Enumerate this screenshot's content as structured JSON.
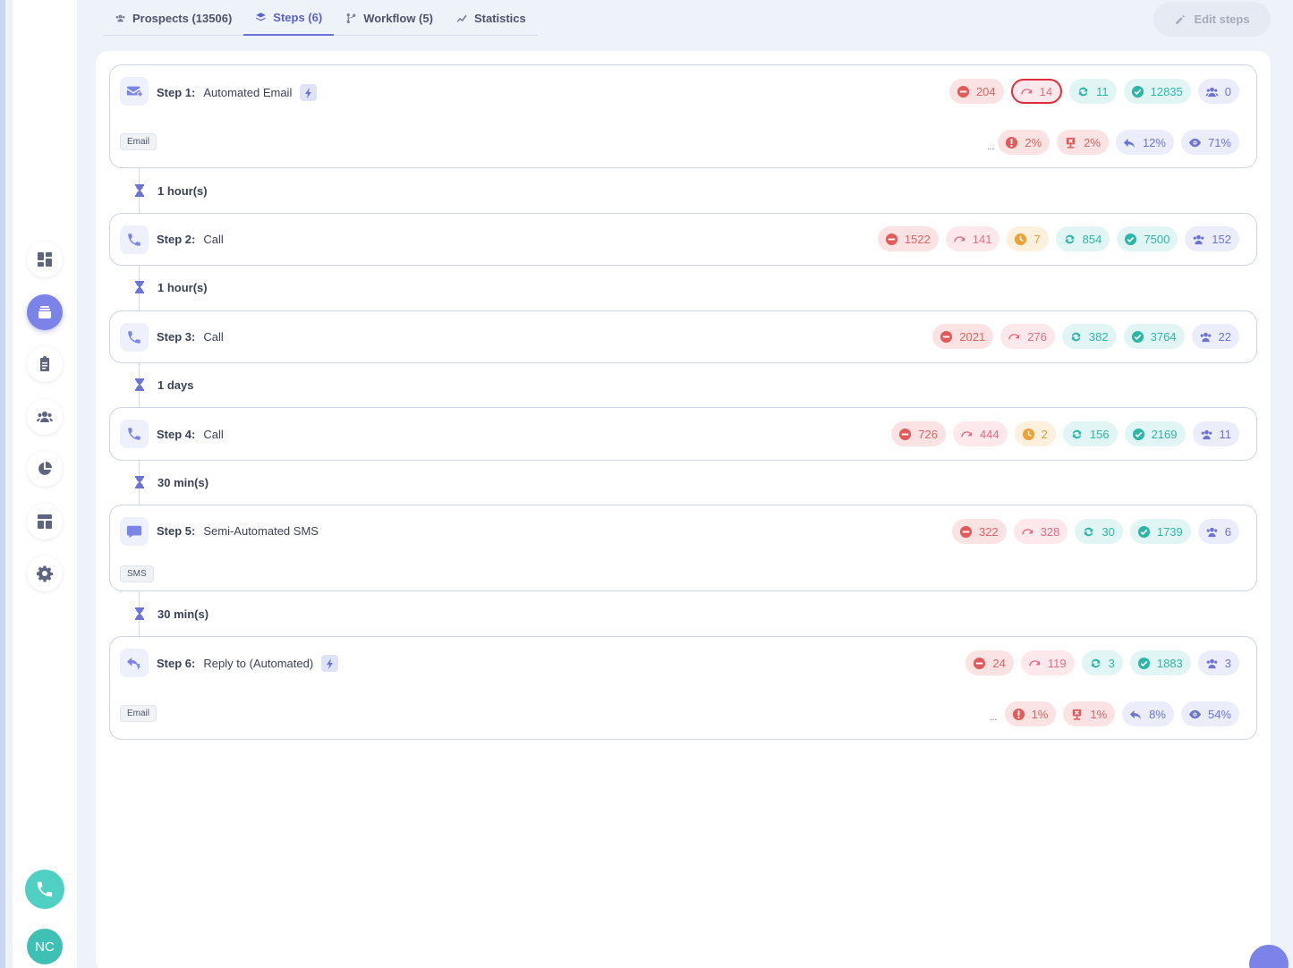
{
  "tabs": [
    {
      "label": "Prospects (13506)",
      "icon": "users-icon"
    },
    {
      "label": "Steps (6)",
      "icon": "layers-icon",
      "active": true
    },
    {
      "label": "Workflow (5)",
      "icon": "workflow-icon"
    },
    {
      "label": "Statistics",
      "icon": "chart-line-icon"
    }
  ],
  "edit_steps_label": "Edit steps",
  "avatar_initials": "NC",
  "colors": {
    "accent": "#7b82e8",
    "teal": "#4fd0c3",
    "danger": "#e06262",
    "success": "#2fb5a7"
  },
  "steps": [
    {
      "num": "Step 1:",
      "name": "Automated Email",
      "type": "email",
      "automated": true,
      "stats": {
        "rejected": "204",
        "bounced": "14",
        "synced": "11",
        "completed": "12835",
        "people": "0"
      },
      "channel": "Email",
      "ellipsis": "...",
      "rates": {
        "error": "2%",
        "unsubscribed": "2%",
        "replied": "12%",
        "opened": "71%"
      }
    },
    {
      "delay": "1 hour(s)"
    },
    {
      "num": "Step 2:",
      "name": "Call",
      "type": "call",
      "stats": {
        "rejected": "1522",
        "bounced": "141",
        "pending": "7",
        "synced": "854",
        "completed": "7500",
        "people": "152"
      }
    },
    {
      "delay": "1 hour(s)"
    },
    {
      "num": "Step 3:",
      "name": "Call",
      "type": "call",
      "stats": {
        "rejected": "2021",
        "bounced": "276",
        "synced": "382",
        "completed": "3764",
        "people": "22"
      }
    },
    {
      "delay": "1 days"
    },
    {
      "num": "Step 4:",
      "name": "Call",
      "type": "call",
      "stats": {
        "rejected": "726",
        "bounced": "444",
        "pending": "2",
        "synced": "156",
        "completed": "2169",
        "people": "11"
      }
    },
    {
      "delay": "30 min(s)"
    },
    {
      "num": "Step 5:",
      "name": "Semi-Automated SMS",
      "type": "sms",
      "stats": {
        "rejected": "322",
        "bounced": "328",
        "synced": "30",
        "completed": "1739",
        "people": "6"
      },
      "channel": "SMS"
    },
    {
      "delay": "30 min(s)"
    },
    {
      "num": "Step 6:",
      "name": "Reply to (Automated)",
      "type": "reply",
      "automated": true,
      "stats": {
        "rejected": "24",
        "bounced": "119",
        "synced": "3",
        "completed": "1883",
        "people": "3"
      },
      "channel": "Email",
      "ellipsis": "...",
      "rates": {
        "error": "1%",
        "unsubscribed": "1%",
        "replied": "8%",
        "opened": "54%"
      }
    }
  ]
}
